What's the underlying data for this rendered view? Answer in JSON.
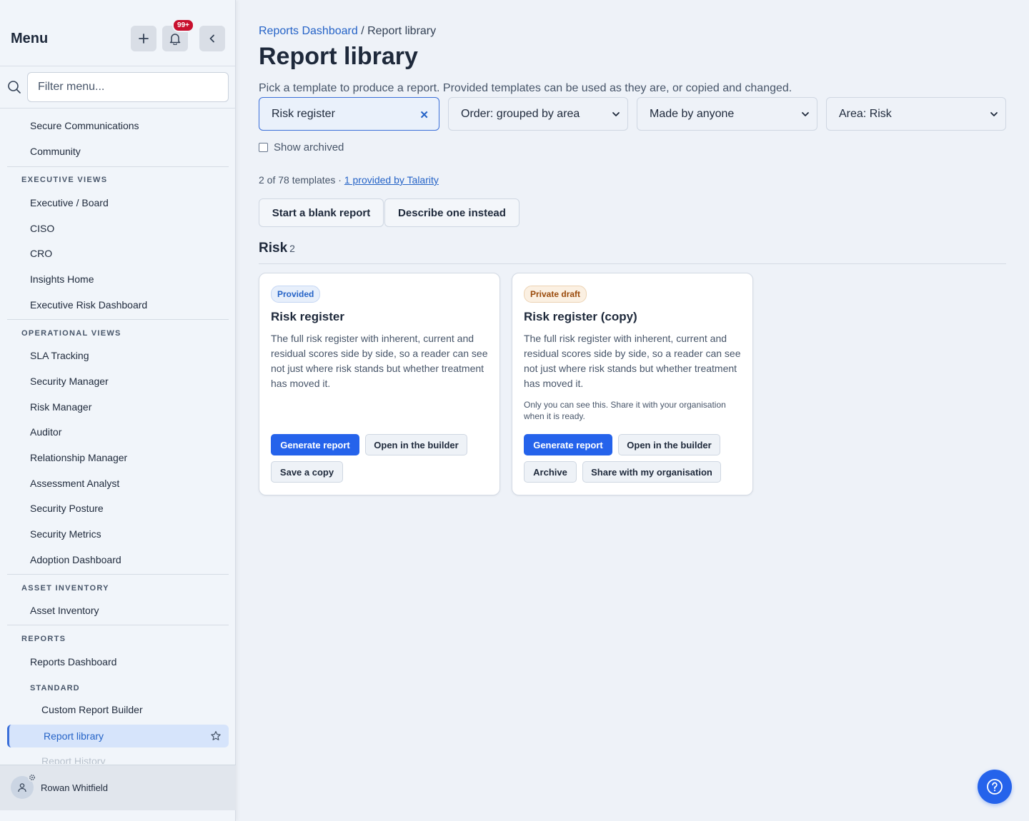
{
  "sidebar": {
    "title": "Menu",
    "notification_count": "99+",
    "filter_placeholder": "Filter menu...",
    "top_items": [
      "Secure Communications",
      "Community"
    ],
    "sections": [
      {
        "heading": "EXECUTIVE VIEWS",
        "items": [
          "Executive / Board",
          "CISO",
          "CRO",
          "Insights Home",
          "Executive Risk Dashboard"
        ]
      },
      {
        "heading": "OPERATIONAL VIEWS",
        "items": [
          "SLA Tracking",
          "Security Manager",
          "Risk Manager",
          "Auditor",
          "Relationship Manager",
          "Assessment Analyst",
          "Security Posture",
          "Security Metrics",
          "Adoption Dashboard"
        ]
      },
      {
        "heading": "ASSET INVENTORY",
        "items": [
          "Asset Inventory"
        ]
      },
      {
        "heading": "REPORTS",
        "items": [
          "Reports Dashboard"
        ],
        "subheading": "STANDARD",
        "sub_items": [
          "Custom Report Builder",
          "Report library",
          "Report History"
        ],
        "active_item": "Report library"
      }
    ],
    "user": {
      "name": "Rowan Whitfield"
    }
  },
  "main": {
    "breadcrumb": {
      "parent": "Reports Dashboard",
      "separator": " / ",
      "current": "Report library"
    },
    "title": "Report library",
    "description": "Pick a template to produce a report. Provided templates can be used as they are, or copied and changed.",
    "filters": {
      "search_value": "Risk register",
      "order": "Order: grouped by area",
      "made_by": "Made by anyone",
      "area": "Area: Risk"
    },
    "show_archived_label": "Show archived",
    "template_count": "2 of 78 templates · ",
    "provided_link": "1 provided by Talarity",
    "actions": {
      "blank": "Start a blank report",
      "describe": "Describe one instead"
    },
    "group": {
      "name": "Risk",
      "count": "2"
    },
    "cards": [
      {
        "badge": "Provided",
        "title": "Risk register",
        "description": "The full risk register with inherent, current and residual scores side by side, so a reader can see not just where risk stands but whether treatment has moved it.",
        "note": "",
        "buttons": [
          "Generate report",
          "Open in the builder",
          "Save a copy"
        ]
      },
      {
        "badge": "Private draft",
        "title": "Risk register (copy)",
        "description": "The full risk register with inherent, current and residual scores side by side, so a reader can see not just where risk stands but whether treatment has moved it.",
        "note": "Only you can see this. Share it with your organisation when it is ready.",
        "buttons": [
          "Generate report",
          "Open in the builder",
          "Archive",
          "Share with my organisation"
        ]
      }
    ]
  },
  "colors": {
    "accent": "#2563eb",
    "link": "#2563c7",
    "badge_red": "#c8102e",
    "draft_text": "#9a4a0b"
  }
}
